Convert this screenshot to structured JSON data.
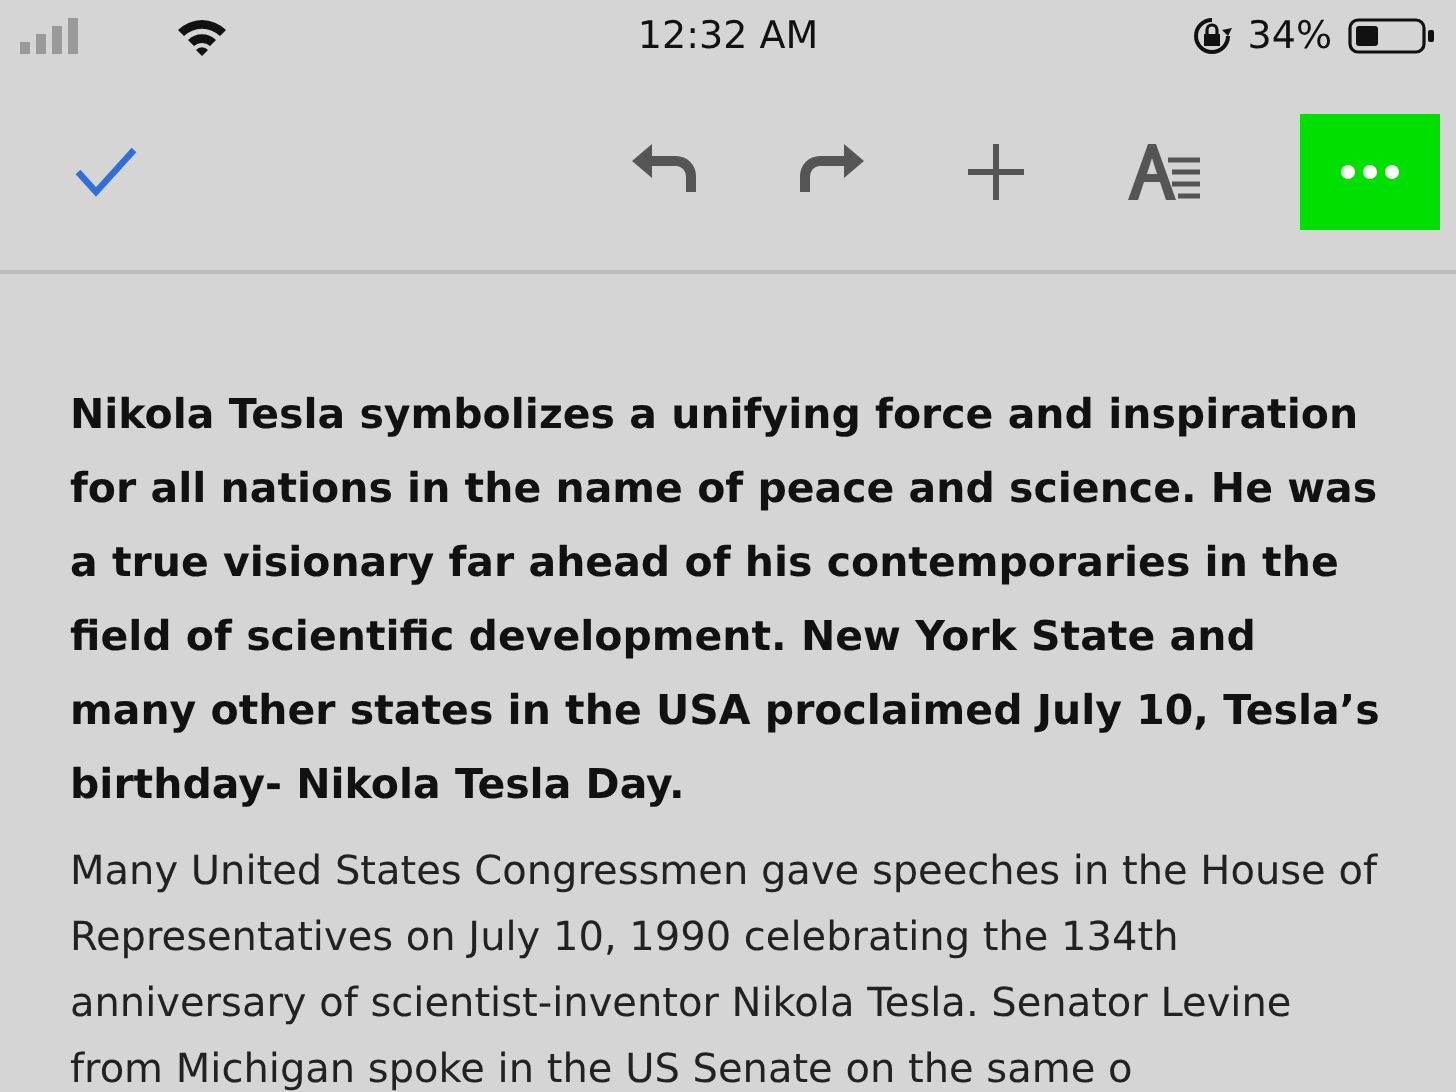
{
  "status_bar": {
    "time": "12:32 AM",
    "battery": "34%"
  },
  "toolbar": {
    "buttons": [
      {
        "kind": "undo",
        "disabled": false
      },
      {
        "kind": "redo",
        "disabled": false
      },
      {
        "kind": "add",
        "disabled": false
      },
      {
        "kind": "format",
        "disabled": false
      },
      {
        "kind": "more",
        "disabled": false
      }
    ]
  },
  "document": {
    "paragraphs": [
      {
        "kind": "bold",
        "text": "Nikola Tesla symbolizes a unifying force and inspiration for all nations in the name of peace and science. He was a true visionary far ahead of his contemporaries in the field of scientific development. New York State and many other states in the USA proclaimed July 10, Tesla’s birthday- Nikola Tesla Day."
      },
      {
        "kind": "normal",
        "text": "Many United States Congressmen gave speeches in the House of Representatives on July 10, 1990 celebrating the 134th anniversary of scientist-inventor Nikola Tesla. Senator Levine from Michigan spoke in the US Senate on the same o"
      }
    ]
  }
}
